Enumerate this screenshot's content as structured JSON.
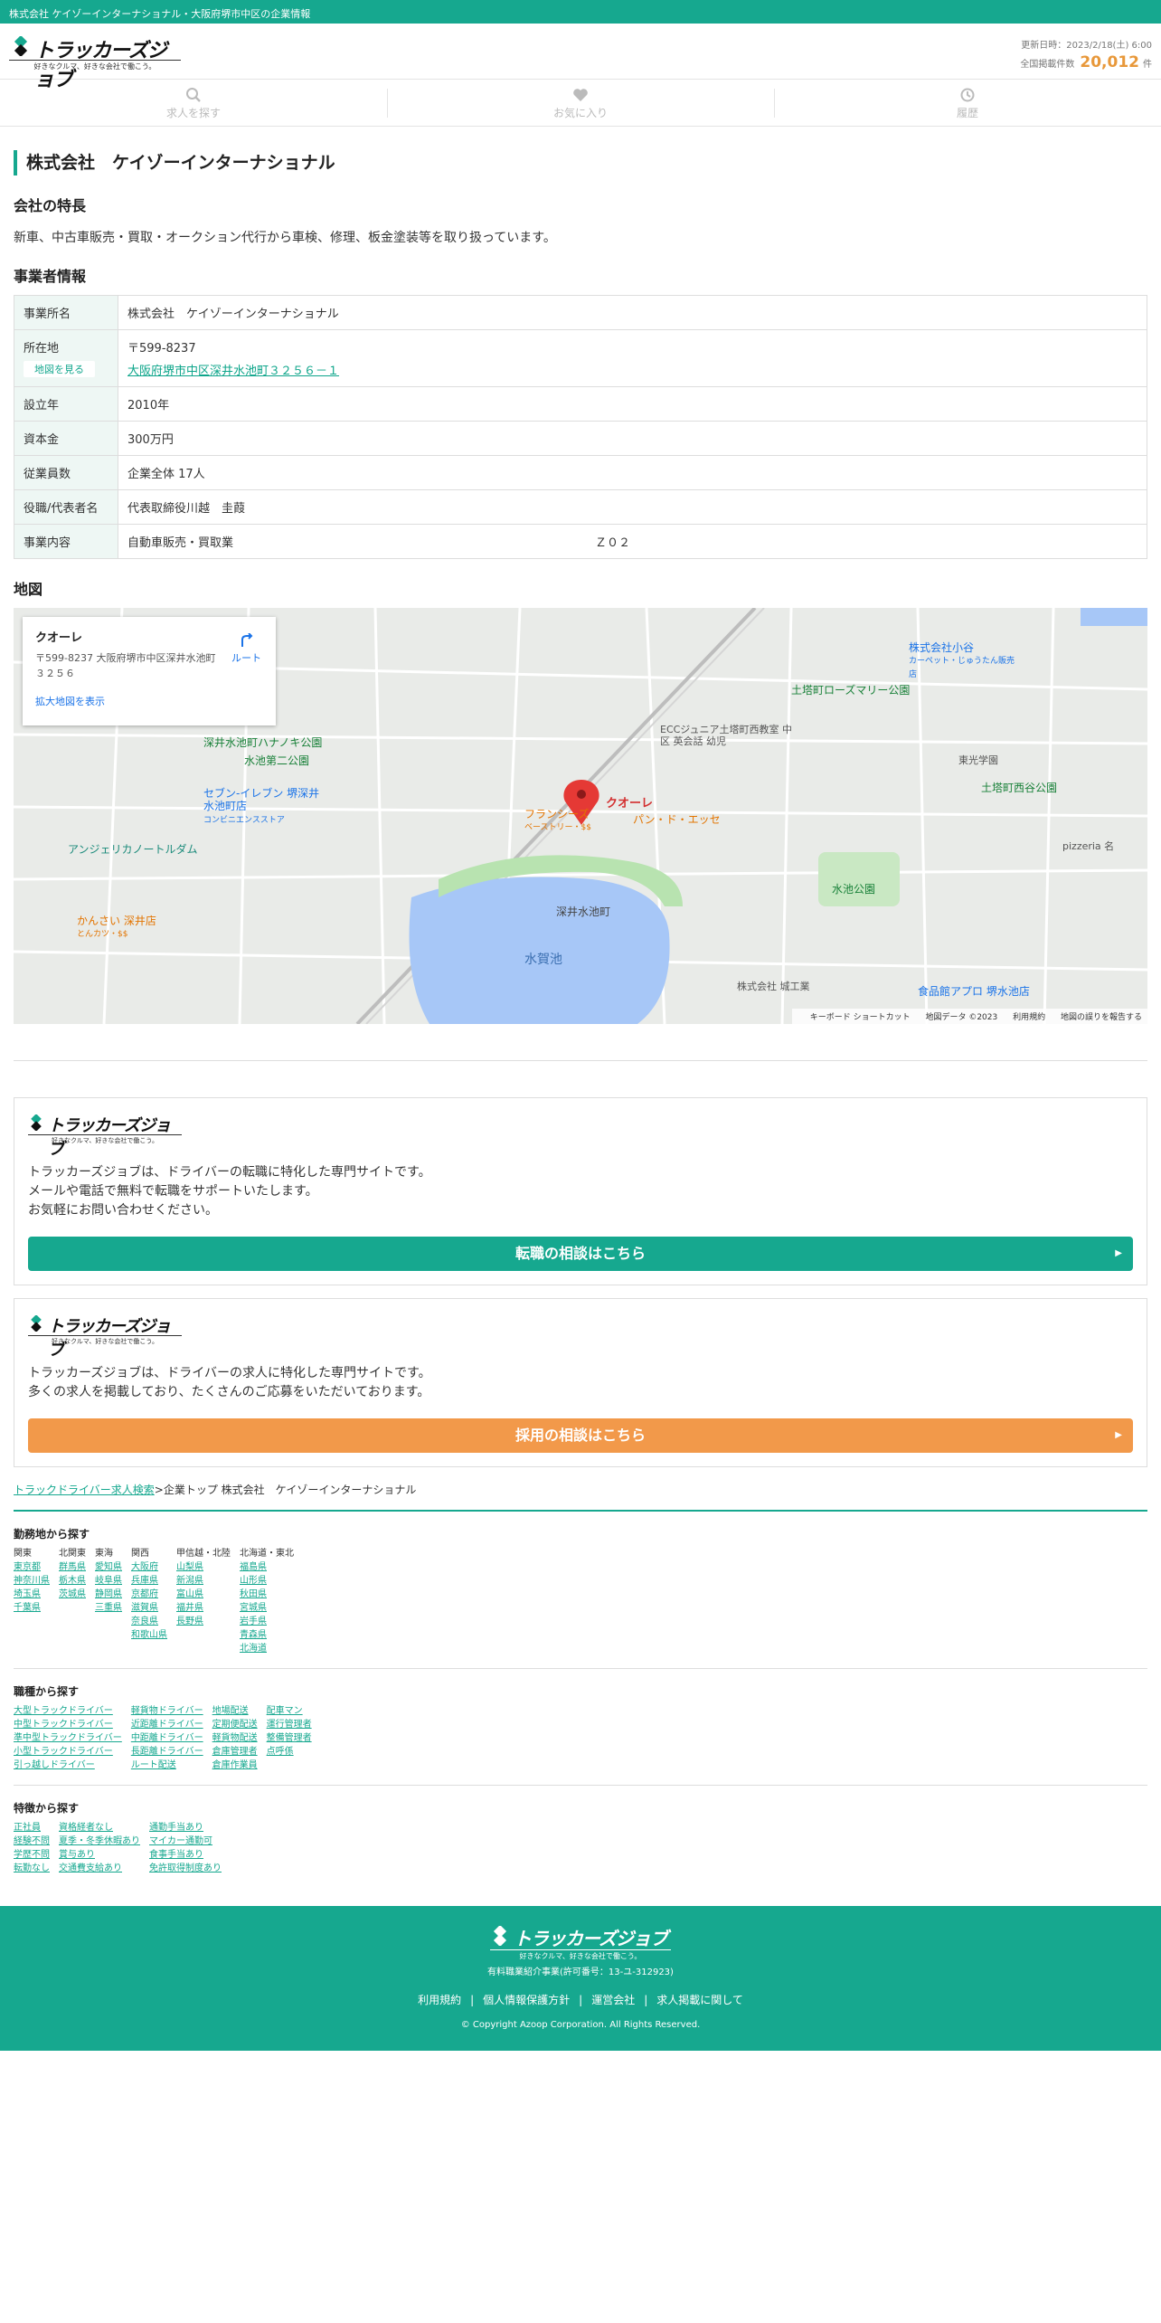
{
  "topbar": {
    "text": "株式会社 ケイゾーインターナショナル・大阪府堺市中区の企業情報"
  },
  "header": {
    "logo_text": "トラッカーズジョブ",
    "logo_tagline": "好きなクルマ、好きな会社で働こう。",
    "updated": "更新日時：2023/2/18(土) 6:00",
    "count_label": "全国掲載件数",
    "count": "20,012",
    "count_unit": "件"
  },
  "nav": {
    "search": "求人を探す",
    "favorites": "お気に入り",
    "history": "履歴"
  },
  "page": {
    "title": "株式会社　ケイゾーインターナショナル",
    "features_heading": "会社の特長",
    "features_text": "新車、中古車販売・買取・オークション代行から車検、修理、板金塗装等を取り扱っています。",
    "business_heading": "事業者情報",
    "map_heading": "地図"
  },
  "info": {
    "name_label": "事業所名",
    "name": "株式会社　ケイゾーインターナショナル",
    "location_label": "所在地",
    "map_button": "地図を見る",
    "zip": "〒599-8237",
    "address": "大阪府堺市中区深井水池町３２５６－１",
    "founded_label": "設立年",
    "founded": "2010年",
    "capital_label": "資本金",
    "capital": "300万円",
    "employees_label": "従業員数",
    "employees": "企業全体 17人",
    "rep_label": "役職/代表者名",
    "rep": "代表取締役川越　圭葭",
    "business_label": "事業内容",
    "business": "自動車販売・買取業",
    "business_extra": "Ｚ０２"
  },
  "map": {
    "card_name": "クオーレ",
    "card_addr": "〒599-8237 大阪府堺市中区深井水池町３２５６",
    "route": "ルート",
    "bigger": "拡大地図を表示",
    "marker_label": "クオーレ",
    "labels": {
      "park1": "土塔町ローズマリー公園",
      "park2": "土塔町西谷公園",
      "park3": "深井水池町ハナノキ公園",
      "park4": "水池第二公園",
      "park5": "水池公園",
      "store1": "セブン-イレブン 堺深井水池町店",
      "store1_sub": "コンビニエンスストア",
      "store2": "食品館アプロ 堺水池店",
      "store3": "株式会社小谷",
      "store3_sub": "カーペット・じゅうたん販売店",
      "rest1": "フランシーズ",
      "rest1_sub": "ベーストリー・$$",
      "rest2": "パン・ド・エッセ",
      "rest3": "かんさい 深井店",
      "rest3_sub": "とんカツ・$$",
      "school": "ECCジュニア土塔町西教室 中区 英会話 幼児",
      "area": "深井水池町",
      "lake": "水賀池",
      "angel": "アンジェリカノートルダム",
      "pizzeria": "pizzeria 名",
      "kouyou": "東光学園",
      "company": "株式会社 城工業"
    },
    "footer_keys": "キーボード ショートカット",
    "footer_data": "地図データ ©2023",
    "footer_terms": "利用規約",
    "footer_report": "地図の誤りを報告する"
  },
  "promo": [
    {
      "text": "トラッカーズジョブは、ドライバーの転職に特化した専門サイトです。\nメールや電話で無料で転職をサポートいたします。\nお気軽にお問い合わせください。",
      "button": "転職の相談はこちら"
    },
    {
      "text": "トラッカーズジョブは、ドライバーの求人に特化した専門サイトです。\n多くの求人を掲載しており、たくさんのご応募をいただいております。",
      "button": "採用の相談はこちら"
    }
  ],
  "breadcrumb": {
    "home": "トラックドライバー求人検索",
    "sep": ">",
    "current": "企業トップ 株式会社　ケイゾーインターナショナル"
  },
  "search_area": {
    "heading": "勤務地から探す",
    "columns": [
      {
        "head": "関東",
        "items": [
          "東京都",
          "神奈川県",
          "埼玉県",
          "千葉県"
        ]
      },
      {
        "head": "北関東",
        "items": [
          "群馬県",
          "栃木県",
          "茨城県"
        ]
      },
      {
        "head": "東海",
        "items": [
          "愛知県",
          "岐阜県",
          "静岡県",
          "三重県"
        ]
      },
      {
        "head": "関西",
        "items": [
          "大阪府",
          "兵庫県",
          "京都府",
          "滋賀県",
          "奈良県",
          "和歌山県"
        ]
      },
      {
        "head": "甲信越・北陸",
        "items": [
          "山梨県",
          "新潟県",
          "富山県",
          "福井県",
          "長野県"
        ]
      },
      {
        "head": "北海道・東北",
        "items": [
          "福島県",
          "山形県",
          "秋田県",
          "宮城県",
          "岩手県",
          "青森県",
          "北海道"
        ]
      }
    ]
  },
  "search_job": {
    "heading": "職種から探す",
    "columns": [
      {
        "items": [
          "大型トラックドライバー",
          "中型トラックドライバー",
          "準中型トラックドライバー",
          "小型トラックドライバー",
          "引っ越しドライバー"
        ]
      },
      {
        "items": [
          "軽貨物ドライバー",
          "近距離ドライバー",
          "中距離ドライバー",
          "長距離ドライバー",
          "ルート配送"
        ]
      },
      {
        "items": [
          "地場配送",
          "定期便配送",
          "軽貨物配送",
          "倉庫管理者",
          "倉庫作業員"
        ]
      },
      {
        "items": [
          "配車マン",
          "運行管理者",
          "整備管理者",
          "点呼係"
        ]
      }
    ]
  },
  "search_feat": {
    "heading": "特徴から探す",
    "columns": [
      {
        "items": [
          "正社員",
          "経験不問",
          "学歴不問",
          "転勤なし"
        ]
      },
      {
        "items": [
          "資格経者なし",
          "夏季・冬季休暇あり",
          "賞与あり",
          "交通費支給あり"
        ]
      },
      {
        "items": [
          "通勤手当あり",
          "マイカー通勤可",
          "食事手当あり",
          "免許取得制度あり"
        ]
      }
    ]
  },
  "footer": {
    "license": "有料職業紹介事業(許可番号：13-ユ-312923)",
    "links": [
      "利用規約",
      "個人情報保護方針",
      "運営会社",
      "求人掲載に関して"
    ],
    "copyright": "© Copyright Azoop Corporation. All Rights Reserved."
  },
  "colors": {
    "brand": "#16a88f",
    "accent": "#f2994a",
    "count": "#e8983a"
  }
}
